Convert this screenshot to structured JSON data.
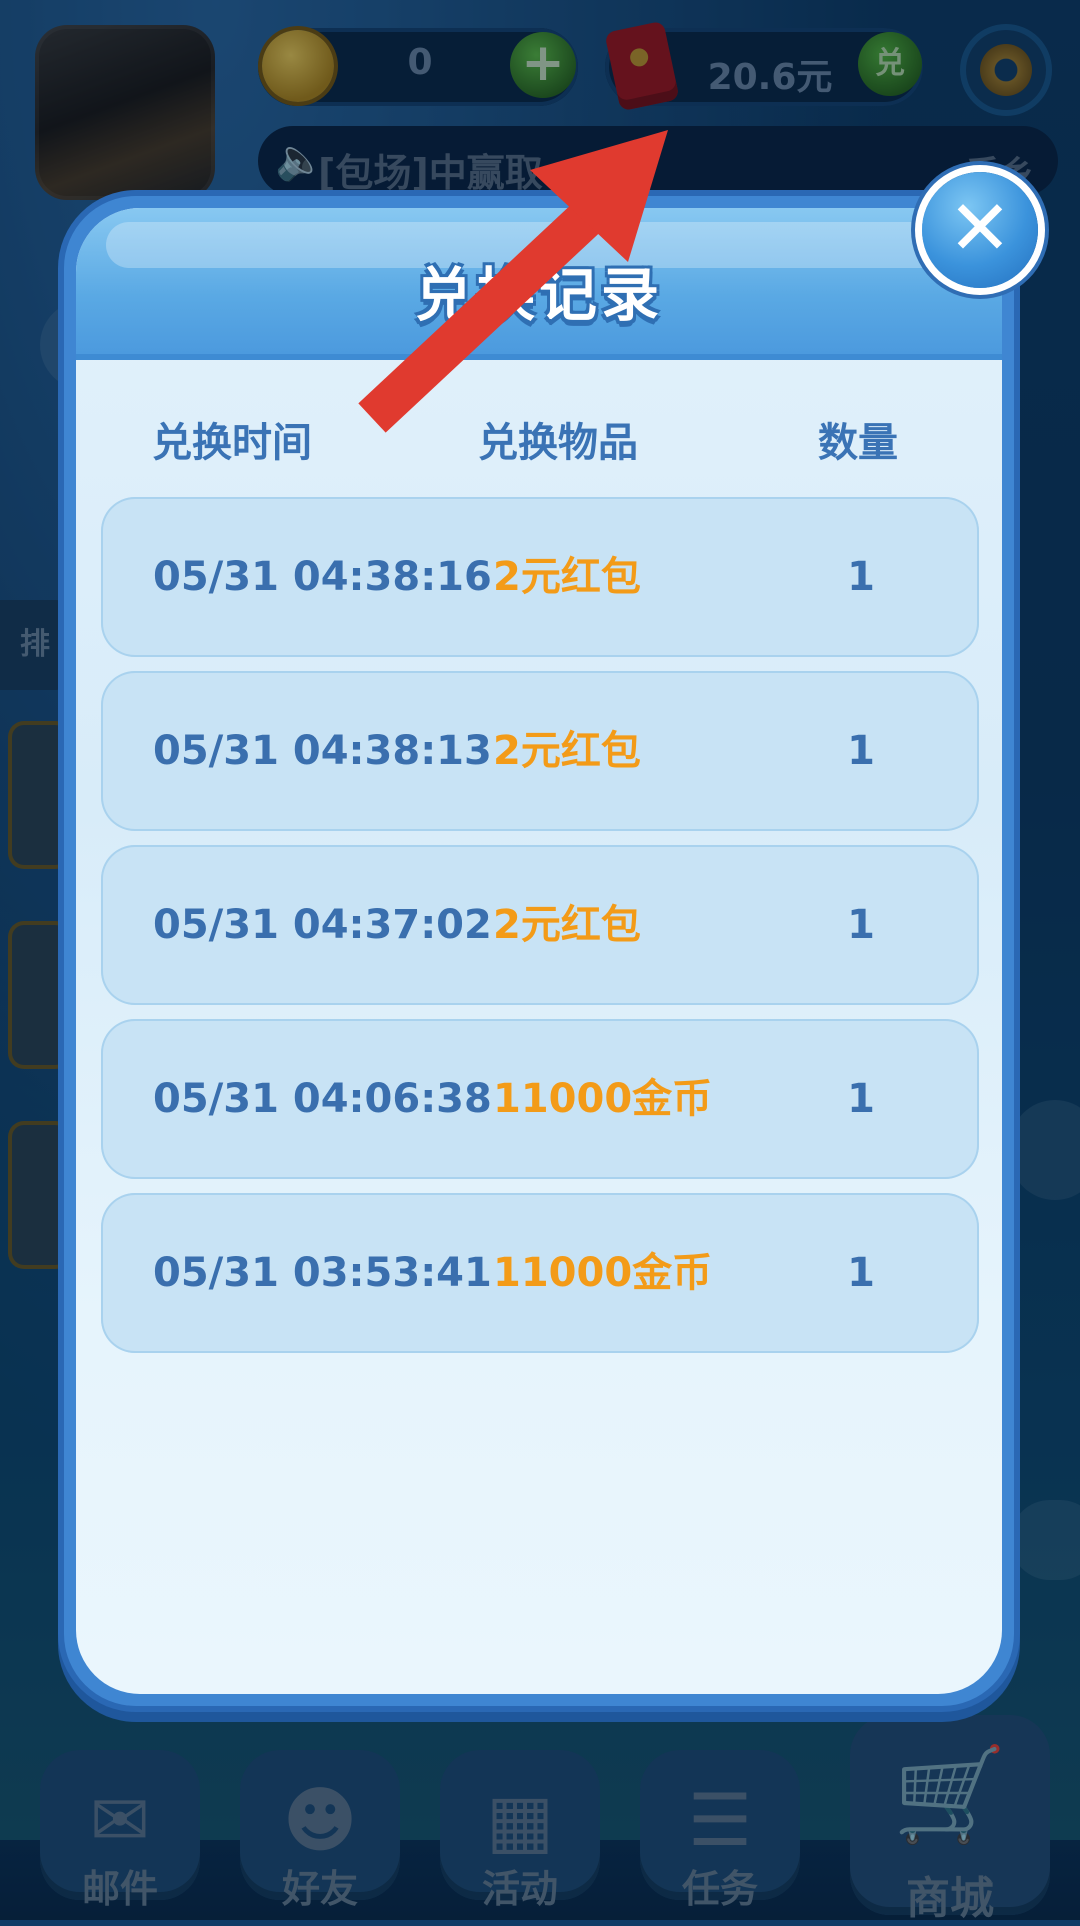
{
  "topbar": {
    "coins": "0",
    "cash": "20.6元",
    "exchange_badge": "兑"
  },
  "marquee": {
    "text": "[包场]中赢取",
    "right_text": "系乡"
  },
  "side": {
    "tab_label": "排"
  },
  "modal": {
    "title": "兑换记录",
    "columns": {
      "time": "兑换时间",
      "item": "兑换物品",
      "quantity": "数量"
    },
    "rows": [
      {
        "time": "05/31  04:38:16",
        "item": "2元红包",
        "quantity": "1"
      },
      {
        "time": "05/31  04:38:13",
        "item": "2元红包",
        "quantity": "1"
      },
      {
        "time": "05/31  04:37:02",
        "item": "2元红包",
        "quantity": "1"
      },
      {
        "time": "05/31  04:06:38",
        "item": "11000金币",
        "quantity": "1"
      },
      {
        "time": "05/31  03:53:41",
        "item": "11000金币",
        "quantity": "1"
      }
    ],
    "close_symbol": "✕"
  },
  "bottom_nav": {
    "items": [
      {
        "label": "邮件",
        "icon": "mail-icon"
      },
      {
        "label": "好友",
        "icon": "friends-icon"
      },
      {
        "label": "活动",
        "icon": "gift-icon"
      },
      {
        "label": "任务",
        "icon": "task-icon"
      },
      {
        "label": "商城",
        "icon": "cart-icon"
      }
    ]
  },
  "colors": {
    "accent_blue": "#3a73b5",
    "item_orange": "#f39b18",
    "annotation_arrow": "#e03a2f"
  }
}
